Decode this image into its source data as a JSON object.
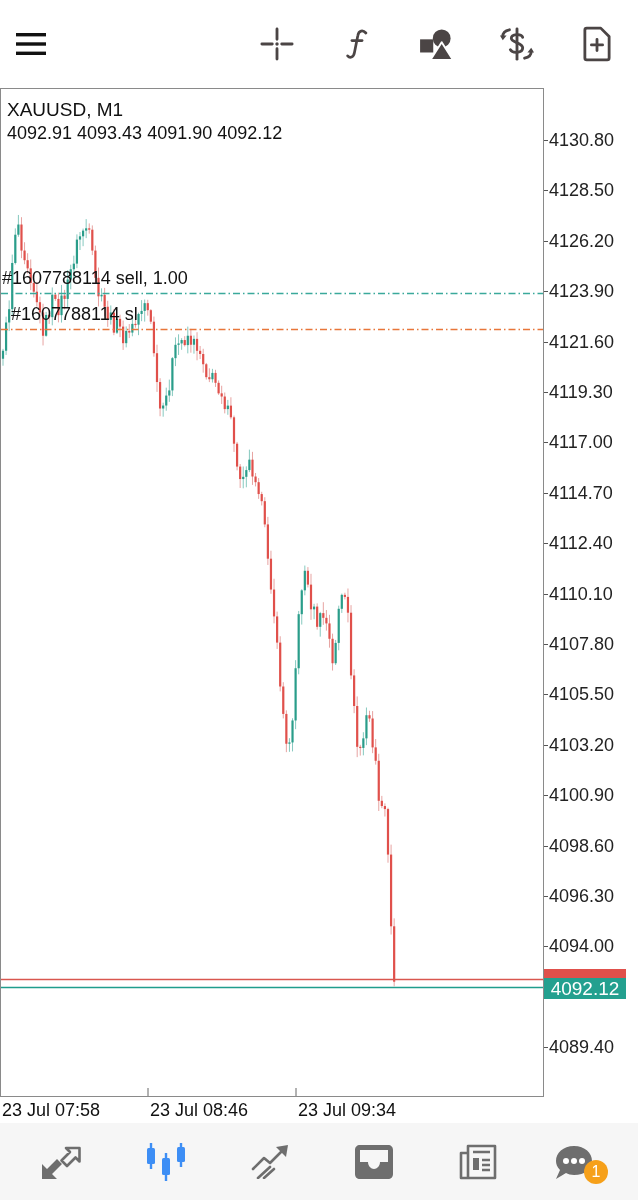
{
  "chart": {
    "symbol": "XAUUSD, M1",
    "ohlc": "4092.91 4093.43 4091.90 4092.12",
    "order_lines": [
      {
        "kind": "position",
        "label": "#1607788114 sell, 1.00",
        "color": "#3aa99b"
      },
      {
        "kind": "stop_loss",
        "label": "#1607788114 sl",
        "color": "#e8763a"
      }
    ],
    "price_axis": [
      "4130.80",
      "4128.50",
      "4126.20",
      "4123.90",
      "4121.60",
      "4119.30",
      "4117.00",
      "4114.70",
      "4112.40",
      "4110.10",
      "4107.80",
      "4105.50",
      "4103.20",
      "4100.90",
      "4098.60",
      "4096.30",
      "4094.00",
      "4089.40"
    ],
    "bid_tag": "4092.12",
    "time_axis": [
      "23 Jul 07:58",
      "23 Jul 08:46",
      "23 Jul 09:34"
    ]
  },
  "bottom_nav": [
    {
      "kind": "trade",
      "selected": false
    },
    {
      "kind": "chart",
      "selected": true
    },
    {
      "kind": "history",
      "selected": false
    },
    {
      "kind": "inbox",
      "selected": false
    },
    {
      "kind": "news",
      "selected": false
    },
    {
      "kind": "chat",
      "selected": false,
      "badge": "1"
    }
  ]
}
